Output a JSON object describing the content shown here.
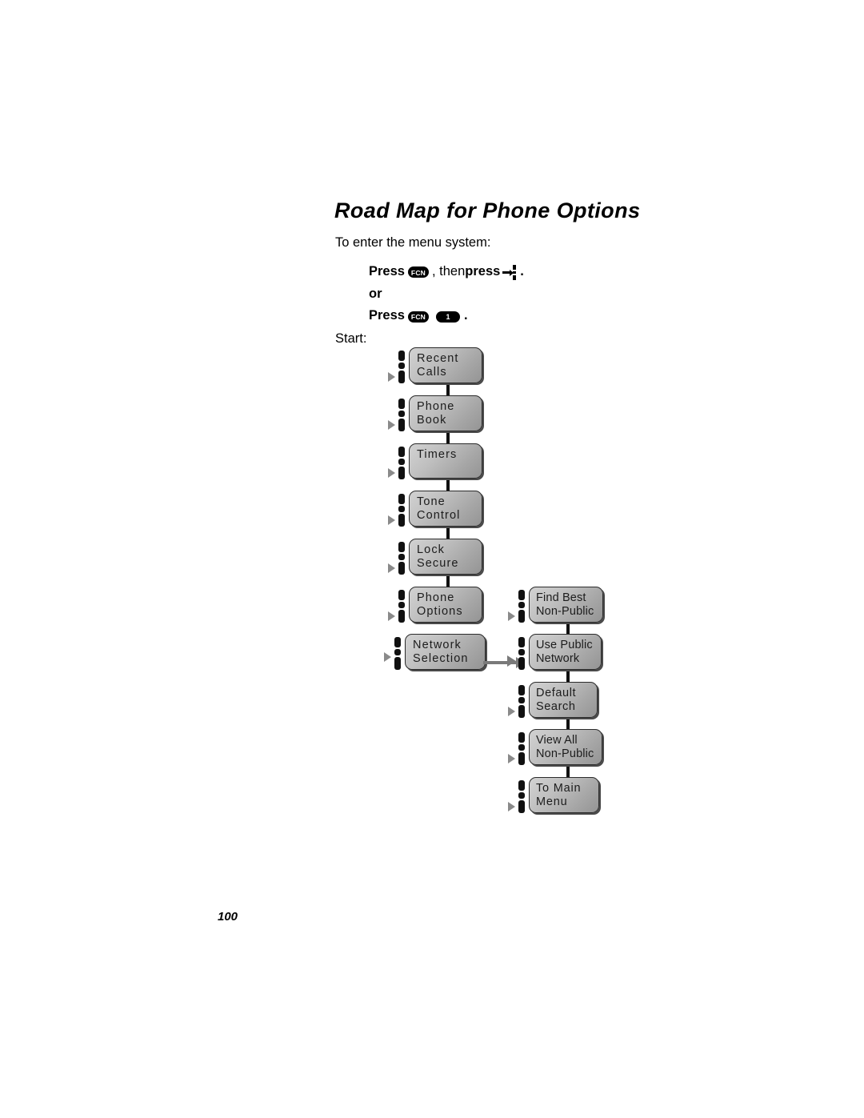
{
  "page": {
    "title": "Road Map for Phone Options",
    "intro": "To enter the menu system:",
    "start_label": "Start:",
    "page_number": "100"
  },
  "instructions": {
    "line1": {
      "press_label": "Press",
      "key1": "FCN",
      "separator": ", then ",
      "press_label2": "press",
      "menu_key_icon": "menu-key-icon",
      "trailing": "."
    },
    "or_label": "or",
    "line2": {
      "press_label": "Press",
      "key1": "FCN",
      "key2": "1",
      "trailing": "."
    }
  },
  "flowchart": {
    "main_menu": [
      {
        "id": "recent-calls",
        "line1": "Recent",
        "line2": "Calls"
      },
      {
        "id": "phone-book",
        "line1": "Phone",
        "line2": "Book"
      },
      {
        "id": "timers",
        "line1": "Timers",
        "line2": ""
      },
      {
        "id": "tone-control",
        "line1": "Tone",
        "line2": "Control"
      },
      {
        "id": "lock-secure",
        "line1": "Lock",
        "line2": "Secure"
      },
      {
        "id": "phone-options",
        "line1": "Phone",
        "line2": "Options"
      },
      {
        "id": "network-selection",
        "line1": "Network",
        "line2": "Selection"
      }
    ],
    "submenu": [
      {
        "id": "find-best-non-public",
        "line1": "Find Best",
        "line2": "Non-Public"
      },
      {
        "id": "use-public-network",
        "line1": "Use Public",
        "line2": "Network"
      },
      {
        "id": "default-search",
        "line1": "Default",
        "line2": "Search"
      },
      {
        "id": "view-all-non-public",
        "line1": "View All",
        "line2": "Non-Public"
      },
      {
        "id": "to-main-menu",
        "line1": "To Main",
        "line2": "Menu"
      }
    ],
    "colors": {
      "box_fill_light": "#d2d2d2",
      "box_fill_dark": "#949494",
      "box_border": "#2b2b2b",
      "connector": "#111111",
      "arrow_gray": "#7a7a7a"
    }
  }
}
